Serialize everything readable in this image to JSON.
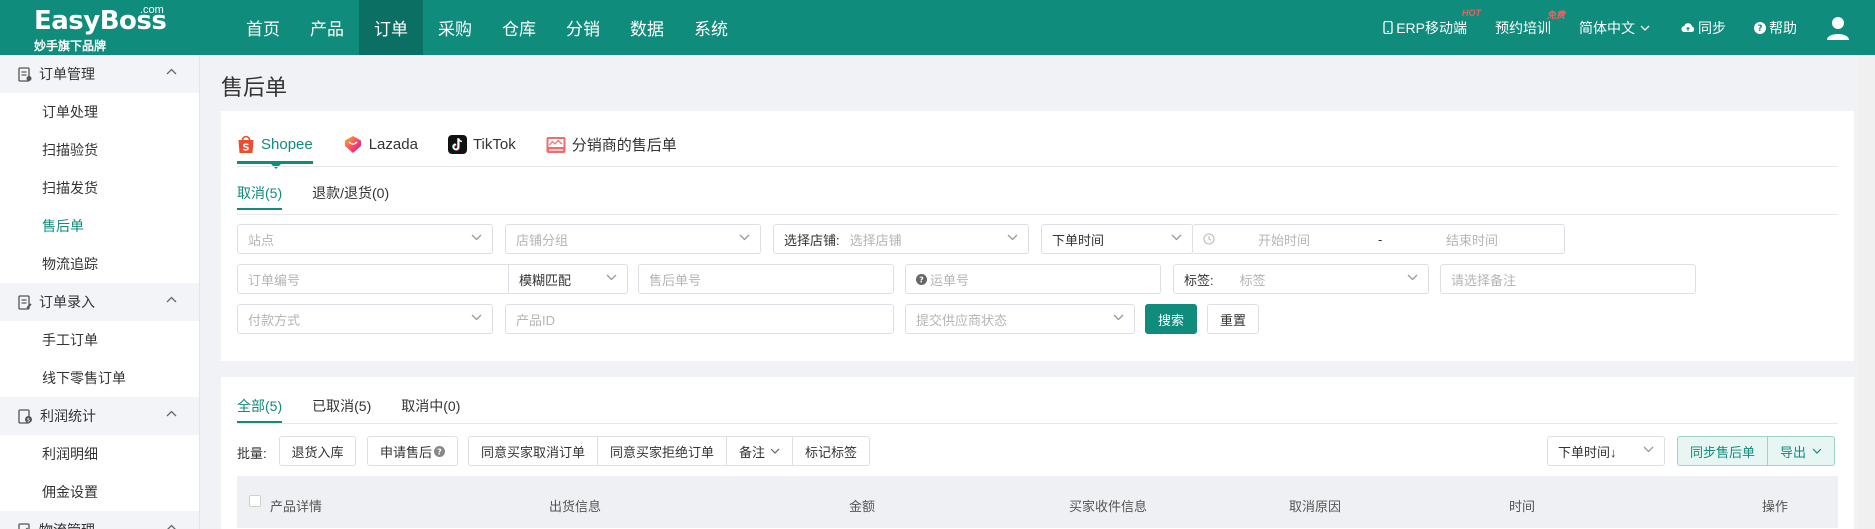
{
  "brand": {
    "name": "EasyBoss",
    "com": ".com",
    "subtitle": "妙手旗下品牌"
  },
  "nav": [
    "首页",
    "产品",
    "订单",
    "采购",
    "仓库",
    "分销",
    "数据",
    "系统"
  ],
  "nav_active": "订单",
  "topright": {
    "erp": "ERP移动端",
    "erp_badge": "HOT",
    "training": "预约培训",
    "training_badge": "免费",
    "language": "简体中文",
    "sync": "同步",
    "help": "帮助"
  },
  "sidebar": {
    "groups": [
      {
        "title": "订单管理",
        "icon": "order-manage-icon",
        "items": [
          "订单处理",
          "扫描验货",
          "扫描发货",
          "售后单",
          "物流追踪"
        ]
      },
      {
        "title": "订单录入",
        "icon": "order-entry-icon",
        "items": [
          "手工订单",
          "线下零售订单"
        ]
      },
      {
        "title": "利润统计",
        "icon": "profit-icon",
        "items": [
          "利润明细",
          "佣金设置"
        ]
      },
      {
        "title": "物流管理",
        "icon": "logistics-icon",
        "items": []
      }
    ],
    "active_item": "售后单"
  },
  "page_title": "售后单",
  "platform_tabs": [
    "Shopee",
    "Lazada",
    "TikTok",
    "分销商的售后单"
  ],
  "type_tabs": [
    "取消(5)",
    "退款/退货(0)"
  ],
  "filters": {
    "site": "站点",
    "shop_group": "店铺分组",
    "shop_label": "选择店铺:",
    "shop_placeholder": "选择店铺",
    "time_type": "下单时间",
    "start_time": "开始时间",
    "range_sep": "-",
    "end_time": "结束时间",
    "order_no": "订单编号",
    "match_mode": "模糊匹配",
    "aftersale_no": "售后单号",
    "tracking_no": "运单号",
    "tag_label": "标签:",
    "tag_placeholder": "标签",
    "remark": "请选择备注",
    "payment": "付款方式",
    "product_id": "产品ID",
    "supplier_status": "提交供应商状态",
    "search": "搜索",
    "reset": "重置"
  },
  "status_tabs": [
    "全部(5)",
    "已取消(5)",
    "取消中(0)"
  ],
  "batch": {
    "label": "批量:",
    "return_stock": "退货入库",
    "apply_aftersale": "申请售后",
    "agree_cancel": "同意买家取消订单",
    "agree_reject": "同意买家拒绝订单",
    "remark": "备注",
    "mark_tag": "标记标签"
  },
  "sort": "下单时间↓",
  "sync_aftersale": "同步售后单",
  "export": "导出",
  "table_headers": [
    "产品详情",
    "出货信息",
    "金额",
    "买家收件信息",
    "取消原因",
    "时间",
    "操作"
  ]
}
